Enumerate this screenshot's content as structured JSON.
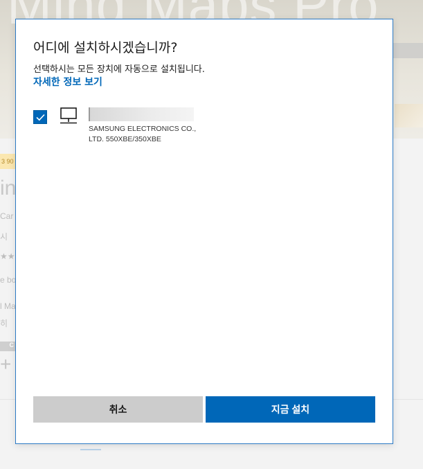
{
  "background": {
    "hero_title": "Mind Maps Pro",
    "fragments": [
      "in",
      "Car",
      "시",
      "★★",
      "e bo",
      "l Ma",
      "히"
    ],
    "badge": "3 90",
    "control_text": "C",
    "plus": "+"
  },
  "dialog": {
    "title": "어디에 설치하시겠습니까?",
    "description": "선택하시는 모든 장치에 자동으로 설치됩니다.",
    "more_info_link": "자세한 정보 보기",
    "device": {
      "checked": true,
      "model_line1": "SAMSUNG ELECTRONICS CO.,",
      "model_line2": "LTD. 550XBE/350XBE",
      "icon": "desktop-computer-icon"
    },
    "buttons": {
      "cancel": "취소",
      "install": "지금 설치"
    }
  },
  "colors": {
    "accent": "#0067b8",
    "dialog_border": "#2b79c4",
    "cancel_bg": "#cccccc"
  }
}
